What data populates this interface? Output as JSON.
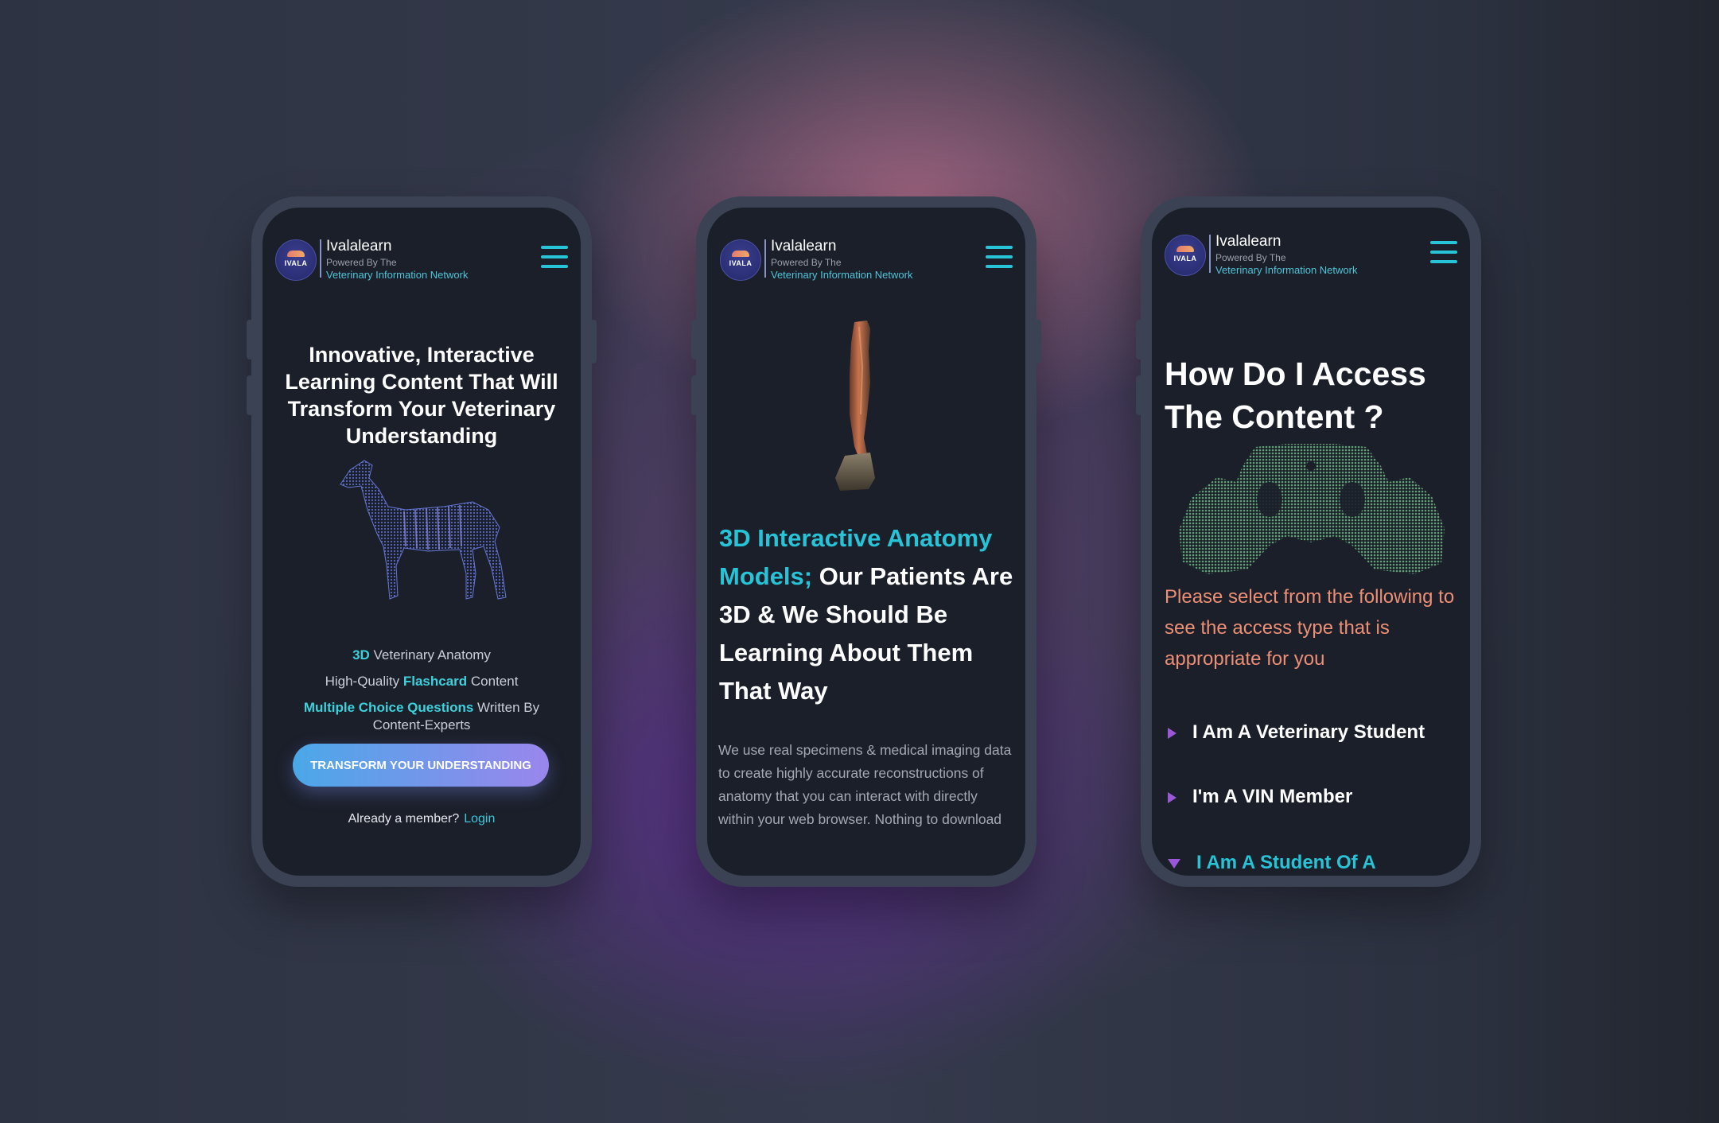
{
  "brand": {
    "name": "Ivalalearn",
    "powered_by": "Powered By The",
    "network": "Veterinary Information Network",
    "logo_text": "IVALA"
  },
  "colors": {
    "accent_cyan": "#27c3d6",
    "salmon": "#ec8f75",
    "purple": "#9a58d8",
    "screen_bg": "#1b1f2a"
  },
  "icons": {
    "menu": "hamburger-menu-icon",
    "option_collapsed": "triangle-right-icon",
    "option_expanded": "triangle-down-icon"
  },
  "phone1": {
    "headline": "Innovative, Interactive Learning  Content That Will Transform Your Veterinary Understanding",
    "features": [
      {
        "highlight": "3D",
        "rest": " Veterinary Anatomy"
      },
      {
        "pre": "High-Quality ",
        "highlight": "Flashcard",
        "post": " Content"
      },
      {
        "highlight": "Multiple Choice Questions",
        "rest": " Written By Content-Experts"
      }
    ],
    "cta_label": "TRANSFORM YOUR UNDERSTANDING",
    "member_text": "Already a member?",
    "login_label": "Login"
  },
  "phone2": {
    "headline_cyan": "3D Interactive Anatomy Models;",
    "headline_white": " Our Patients Are 3D & We Should Be Learning About Them That Way",
    "body": "We use real specimens & medical imaging data to create highly accurate reconstructions of anatomy that you can interact with directly within your web browser. Nothing to download"
  },
  "phone3": {
    "headline": "How Do I Access The Content ?",
    "prompt": "Please select from the following to see the access type that is appropriate for you",
    "options": [
      {
        "label": "I Am A Veterinary Student",
        "expanded": false
      },
      {
        "label": "I'm A VIN Member",
        "expanded": false
      },
      {
        "label": "I Am A Student Of A",
        "expanded": true
      }
    ]
  }
}
